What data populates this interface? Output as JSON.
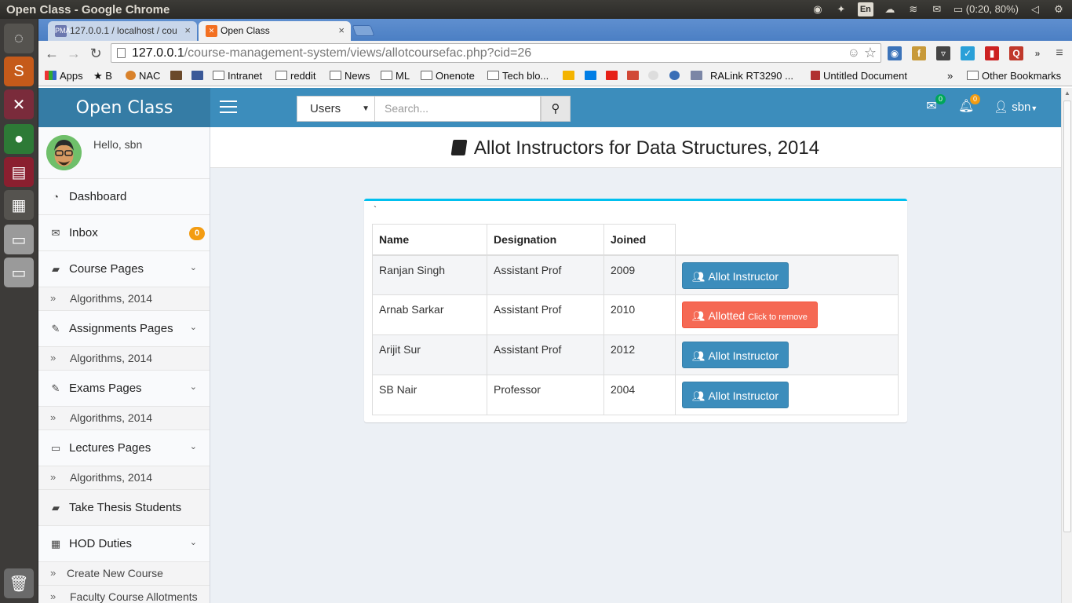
{
  "os": {
    "window_title": "Open Class - Google Chrome",
    "keyboard": "En",
    "battery": "(0:20, 80%)"
  },
  "browser": {
    "tabs": [
      {
        "label": "127.0.0.1 / localhost / cou",
        "favicon": "phpmyadmin-icon"
      },
      {
        "label": "Open Class",
        "favicon": "xampp-icon"
      }
    ],
    "url_host": "127.0.0.1",
    "url_path": "/course-management-system/views/allotcoursefac.php?cid=26",
    "bookmarks": {
      "apps": "Apps",
      "b": "B",
      "nac": "NAC",
      "intranet": "Intranet",
      "reddit": "reddit",
      "news": "News",
      "ml": "ML",
      "onenote": "Onenote",
      "techblog": "Tech blo...",
      "ralink": "RALink RT3290 ...",
      "untitled": "Untitled Document",
      "more": "»",
      "other": "Other Bookmarks"
    }
  },
  "app": {
    "logo": "Open Class",
    "search": {
      "select_value": "Users",
      "placeholder": "Search..."
    },
    "nav": {
      "mail_count": "0",
      "notif_count": "0",
      "user": "sbn"
    },
    "sidebar": {
      "greeting": "Hello, sbn",
      "items": [
        {
          "label": "Dashboard"
        },
        {
          "label": "Inbox",
          "badge": "0"
        },
        {
          "label": "Course Pages",
          "sub": "Algorithms, 2014"
        },
        {
          "label": "Assignments Pages",
          "sub": "Algorithms, 2014"
        },
        {
          "label": "Exams Pages",
          "sub": "Algorithms, 2014"
        },
        {
          "label": "Lectures Pages",
          "sub": "Algorithms, 2014"
        },
        {
          "label": "Take Thesis Students"
        },
        {
          "label": "HOD Duties",
          "subs": [
            "Create New Course",
            "Faculty Course Allotments"
          ]
        }
      ]
    },
    "page_title": "Allot Instructors for Data Structures, 2014",
    "box_tick": "`",
    "table": {
      "headers": [
        "Name",
        "Designation",
        "Joined"
      ],
      "rows": [
        {
          "name": "Ranjan Singh",
          "designation": "Assistant Prof",
          "joined": "2009",
          "action": "Allot Instructor",
          "action_small": "",
          "allotted": false
        },
        {
          "name": "Arnab Sarkar",
          "designation": "Assistant Prof",
          "joined": "2010",
          "action": "Allotted",
          "action_small": "Click to remove",
          "allotted": true
        },
        {
          "name": "Arijit Sur",
          "designation": "Assistant Prof",
          "joined": "2012",
          "action": "Allot Instructor",
          "action_small": "",
          "allotted": false
        },
        {
          "name": "SB Nair",
          "designation": "Professor",
          "joined": "2004",
          "action": "Allot Instructor",
          "action_small": "",
          "allotted": false
        }
      ]
    }
  },
  "colors": {
    "header": "#3c8dbc",
    "logo_bg": "#357ca5",
    "primary_button": "#3c8dbc",
    "danger_button": "#f56954",
    "box_accent": "#00c0ef",
    "badge_orange": "#f39c12",
    "badge_green": "#00a65a"
  }
}
